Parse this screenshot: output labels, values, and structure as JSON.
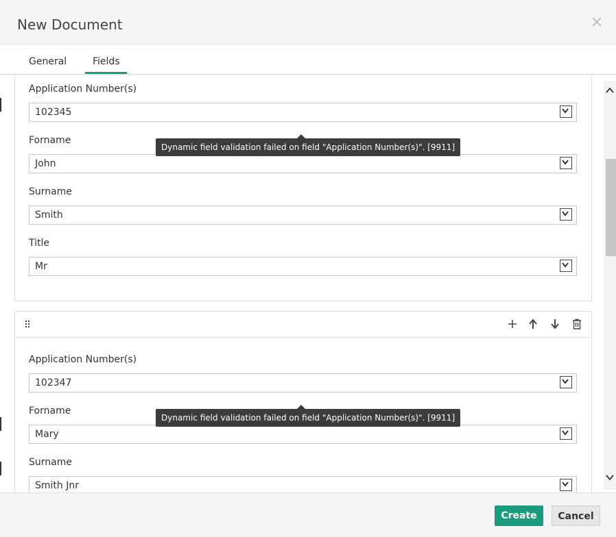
{
  "dialog": {
    "title": "New Document"
  },
  "tabs": [
    {
      "label": "General",
      "active": false
    },
    {
      "label": "Fields",
      "active": true
    }
  ],
  "groups": [
    {
      "fields": [
        {
          "label": "Application Number(s)",
          "value": "102345"
        },
        {
          "label": "Forname",
          "value": "John"
        },
        {
          "label": "Surname",
          "value": "Smith"
        },
        {
          "label": "Title",
          "value": "Mr"
        }
      ],
      "tooltip": "Dynamic field validation failed on field \"Application Number(s)\". [9911]"
    },
    {
      "toolbar": {
        "icons": [
          "drag-handle-icon",
          "add-icon",
          "move-up-icon",
          "move-down-icon",
          "delete-icon"
        ]
      },
      "fields": [
        {
          "label": "Application Number(s)",
          "value": "102347"
        },
        {
          "label": "Forname",
          "value": "Mary"
        },
        {
          "label": "Surname",
          "value": "Smith Jnr"
        }
      ],
      "tooltip": "Dynamic field validation failed on field \"Application Number(s)\". [9911]"
    }
  ],
  "footer": {
    "create_label": "Create",
    "cancel_label": "Cancel"
  },
  "colors": {
    "accent": "#1a9b7d",
    "tooltip_bg": "#3c3c3c"
  }
}
